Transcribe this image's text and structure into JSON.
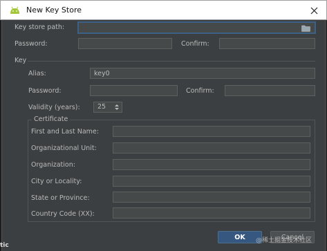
{
  "window": {
    "title": "New Key Store",
    "close_glyph": "×"
  },
  "keystore": {
    "path_label": "Key store path:",
    "path_value": "",
    "password_label": "Password:",
    "password_value": "",
    "confirm_label": "Confirm:",
    "confirm_value": ""
  },
  "key": {
    "section_label": "Key",
    "alias_label": "Alias:",
    "alias_value": "key0",
    "password_label": "Password:",
    "password_value": "",
    "confirm_label": "Confirm:",
    "confirm_value": "",
    "validity_label": "Validity (years):",
    "validity_value": "25"
  },
  "certificate": {
    "section_label": "Certificate",
    "fields": [
      {
        "label": "First and Last Name:",
        "value": ""
      },
      {
        "label": "Organizational Unit:",
        "value": ""
      },
      {
        "label": "Organization:",
        "value": ""
      },
      {
        "label": "City or Locality:",
        "value": ""
      },
      {
        "label": "State or Province:",
        "value": ""
      },
      {
        "label": "Country Code (XX):",
        "value": ""
      }
    ]
  },
  "buttons": {
    "ok_label": "OK",
    "cancel_label": "Cancel"
  },
  "background": {
    "partial_text": "tic",
    "watermark": "@稀土掘金技术社区"
  },
  "icons": {
    "title": "android-icon",
    "folder": "folder-icon",
    "spinner": "spinner-arrows-icon",
    "close": "close-icon"
  },
  "colors": {
    "dialog_bg": "#3c3f41",
    "field_bg": "#45494a",
    "focus_border": "#3d6185",
    "ok_button": "#365880",
    "android_green": "#a4c639"
  }
}
